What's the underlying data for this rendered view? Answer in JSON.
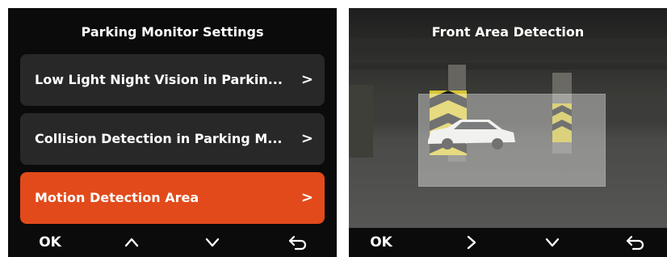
{
  "left_screen": {
    "title": "Parking Monitor Settings",
    "menu": [
      {
        "label": "Low Light Night Vision in Parkin...",
        "chevron": ">",
        "selected": false
      },
      {
        "label": "Collision Detection in Parking M...",
        "chevron": ">",
        "selected": false
      },
      {
        "label": "Motion Detection Area",
        "chevron": ">",
        "selected": true
      }
    ],
    "bottom_bar": {
      "ok": "OK",
      "buttons": [
        "chevron-up-icon",
        "chevron-down-icon",
        "back-arrow-icon"
      ]
    }
  },
  "right_screen": {
    "title": "Front Area Detection",
    "bottom_bar": {
      "ok": "OK",
      "buttons": [
        "chevron-right-icon",
        "chevron-down-icon",
        "back-arrow-icon"
      ]
    }
  },
  "colors": {
    "accent": "#e24a1b",
    "menu_bg": "#282828",
    "screen_bg": "#0b0b0b"
  }
}
